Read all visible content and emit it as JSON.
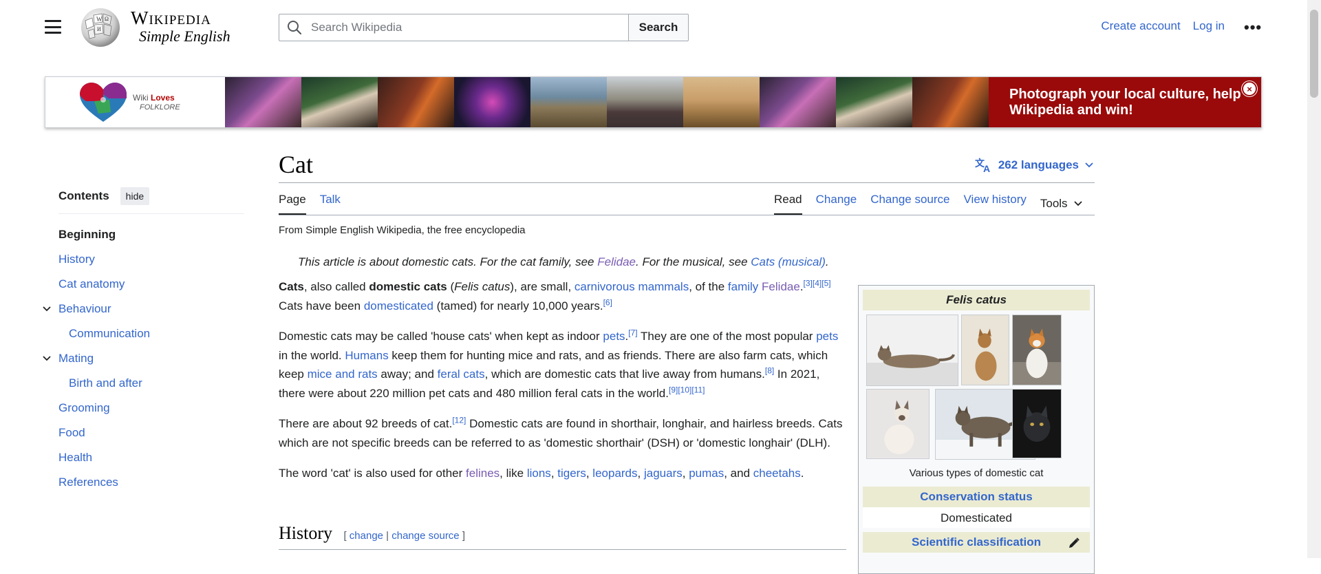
{
  "header": {
    "wordmark_title": "Wikipedia",
    "wordmark_sub": "Simple English",
    "search_placeholder": "Search Wikipedia",
    "search_button": "Search",
    "create_account": "Create account",
    "log_in": "Log in",
    "more": "•••"
  },
  "banner": {
    "logo_line1_prefix": "Wiki ",
    "logo_line1_bold": "Loves",
    "logo_line2": "FOLKLORE",
    "cta": "Photograph your local culture, help Wikipedia and win!",
    "close": "×"
  },
  "toc": {
    "title": "Contents",
    "hide": "hide",
    "items": [
      {
        "label": "Beginning"
      },
      {
        "label": "History"
      },
      {
        "label": "Cat anatomy"
      },
      {
        "label": "Behaviour"
      },
      {
        "label": "Communication"
      },
      {
        "label": "Mating"
      },
      {
        "label": "Birth and after"
      },
      {
        "label": "Grooming"
      },
      {
        "label": "Food"
      },
      {
        "label": "Health"
      },
      {
        "label": "References"
      }
    ]
  },
  "article": {
    "title": "Cat",
    "languages": "262 languages",
    "tabs_left": {
      "page": "Page",
      "talk": "Talk"
    },
    "tabs_right": {
      "read": "Read",
      "change": "Change",
      "change_source": "Change source",
      "view_history": "View history",
      "tools": "Tools"
    },
    "tagline": "From Simple English Wikipedia, the free encyclopedia",
    "hatnote": {
      "t1": "This article is about domestic cats. For the cat family, see ",
      "l1": "Felidae",
      "t2": ". For the musical, see ",
      "l2": "Cats (musical)",
      "t3": "."
    },
    "p1": {
      "b1": "Cats",
      "t1": ", also called ",
      "b2": "domestic cats",
      "t2": " (",
      "i1": "Felis catus",
      "t3": "), are small, ",
      "l1": "carnivorous",
      "t4": " ",
      "l2": "mammals",
      "t5": ", of the ",
      "l3": "family",
      "t6": " ",
      "l4": "Felidae",
      "t7": ".",
      "r1": "[3]",
      "r2": "[4]",
      "r3": "[5]",
      "t8": " Cats have been ",
      "l5": "domesticated",
      "t9": " (tamed) for nearly 10,000 years.",
      "r4": "[6]"
    },
    "p2": {
      "t1": "Domestic cats may be called 'house cats' when kept as indoor ",
      "l1": "pets",
      "t2": ".",
      "r1": "[7]",
      "t3": " They are one of the most popular ",
      "l2": "pets",
      "t4": " in the world. ",
      "l3": "Humans",
      "t5": " keep them for hunting mice and rats, and as friends. There are also farm cats, which keep ",
      "l4": "mice",
      "t6": " ",
      "l5": "and",
      "t7": " ",
      "l6": "rats",
      "t8": " away; and ",
      "l7": "feral cats",
      "t9": ", which are domestic cats that live away from humans.",
      "r2": "[8]",
      "t10": " In 2021, there were about 220 million pet cats and 480 million feral cats in the world.",
      "r3": "[9]",
      "r4": "[10]",
      "r5": "[11]"
    },
    "p3": {
      "t1": "There are about 92 breeds of cat.",
      "r1": "[12]",
      "t2": " Domestic cats are found in shorthair, longhair, and hairless breeds. Cats which are not specific breeds can be referred to as 'domestic shorthair' (DSH) or 'domestic longhair' (DLH)."
    },
    "p4": {
      "t1": "The word 'cat' is also used for other ",
      "l1": "felines",
      "t2": ", like ",
      "l2": "lions",
      "t3": ", ",
      "l3": "tigers",
      "t4": ", ",
      "l4": "leopards",
      "t5": ", ",
      "l5": "jaguars",
      "t6": ", ",
      "l6": "pumas",
      "t7": ", and ",
      "l7": "cheetahs",
      "t8": "."
    },
    "section_history": {
      "title": "History",
      "open": "[ ",
      "change": "change",
      "sep": " | ",
      "change_source": "change source",
      "close": " ]"
    }
  },
  "infobox": {
    "title": "Felis catus",
    "caption": "Various types of domestic cat",
    "conservation_status": "Conservation status",
    "status_value": "Domesticated",
    "scientific_classification": "Scientific classification"
  },
  "colors": {
    "link": "#3366cc",
    "visited": "#795cb2",
    "banner_red": "#9a0a0a",
    "infobox_header": "#ebebd2"
  }
}
